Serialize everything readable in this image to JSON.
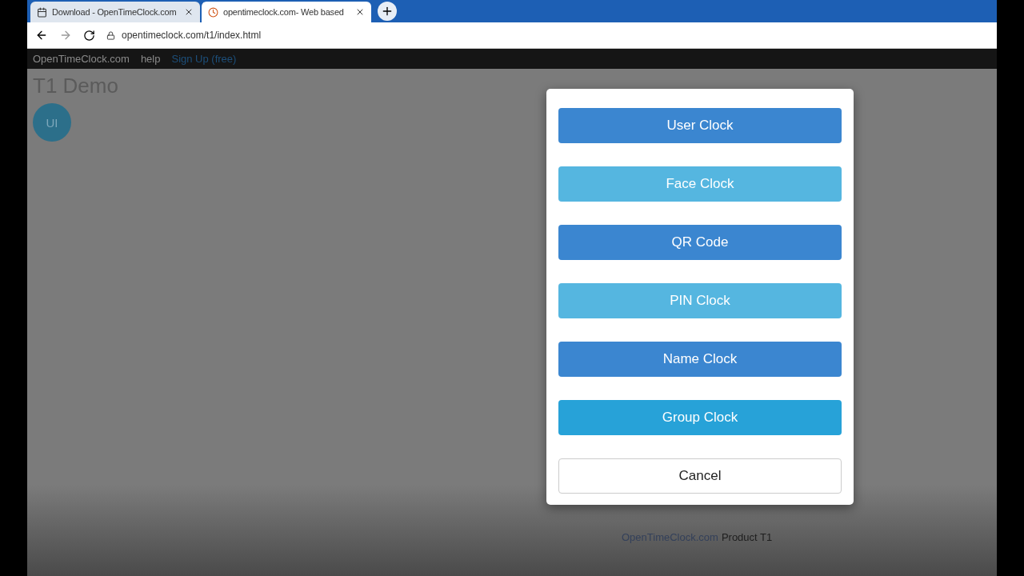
{
  "browser": {
    "tabs": [
      {
        "title": "Download - OpenTimeClock.com",
        "selected": false
      },
      {
        "title": "opentimeclock.com- Web based",
        "selected": true
      }
    ],
    "url": "opentimeclock.com/t1/index.html"
  },
  "navbar": {
    "brand": "OpenTimeClock.com",
    "links": [
      "help",
      "Sign Up (free)"
    ]
  },
  "page": {
    "title": "T1 Demo",
    "avatar": "UI",
    "footer_link": "OpenTimeClock.com",
    "footer_text": "Product T1"
  },
  "dialog": {
    "buttons": [
      {
        "label": "User Clock",
        "kind": "primary",
        "color": "#3b86d0"
      },
      {
        "label": "Face Clock",
        "kind": "primary",
        "color": "#55b6e0"
      },
      {
        "label": "QR Code",
        "kind": "primary",
        "color": "#3b86d0"
      },
      {
        "label": "PIN Clock",
        "kind": "primary",
        "color": "#55b6e0"
      },
      {
        "label": "Name Clock",
        "kind": "primary",
        "color": "#3b86d0"
      },
      {
        "label": "Group Clock",
        "kind": "primary",
        "color": "#27a2d8"
      },
      {
        "label": "Cancel",
        "kind": "default"
      }
    ]
  }
}
